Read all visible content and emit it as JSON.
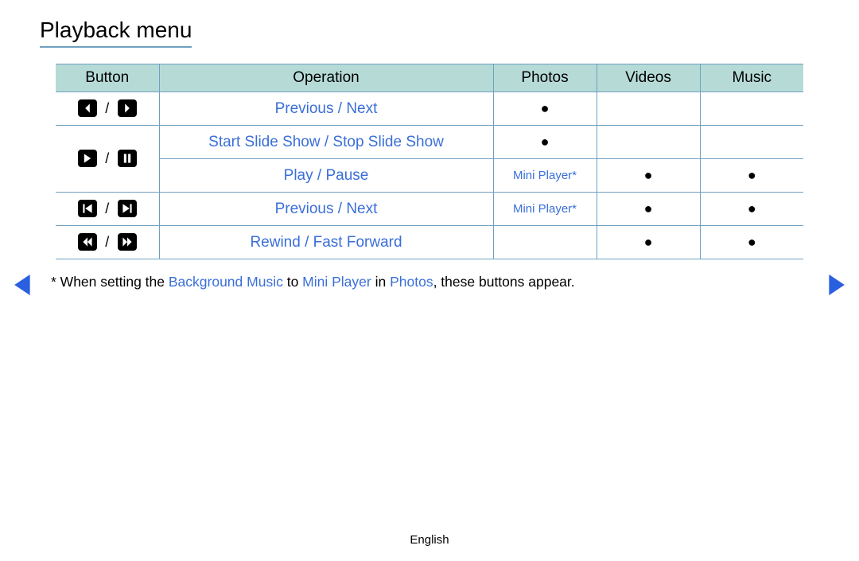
{
  "title": "Playback menu",
  "headers": {
    "button": "Button",
    "operation": "Operation",
    "photos": "Photos",
    "videos": "Videos",
    "music": "Music"
  },
  "rows": {
    "r1": {
      "operation": "Previous / Next",
      "photos": "●",
      "videos": "",
      "music": ""
    },
    "r2a": {
      "operation": "Start Slide Show / Stop Slide Show",
      "photos": "●",
      "videos": "",
      "music": ""
    },
    "r2b": {
      "operation": "Play / Pause",
      "photos": "Mini Player*",
      "videos": "●",
      "music": "●"
    },
    "r3": {
      "operation": "Previous / Next",
      "photos": "Mini Player*",
      "videos": "●",
      "music": "●"
    },
    "r4": {
      "operation": "Rewind / Fast Forward",
      "photos": "",
      "videos": "●",
      "music": "●"
    }
  },
  "button_separator": "/",
  "note": {
    "prefix": "* When setting the ",
    "bg_music": "Background Music",
    "to": " to ",
    "mini_player": "Mini Player",
    "in": " in ",
    "photos": "Photos",
    "suffix": ", these buttons appear."
  },
  "footer": "English"
}
